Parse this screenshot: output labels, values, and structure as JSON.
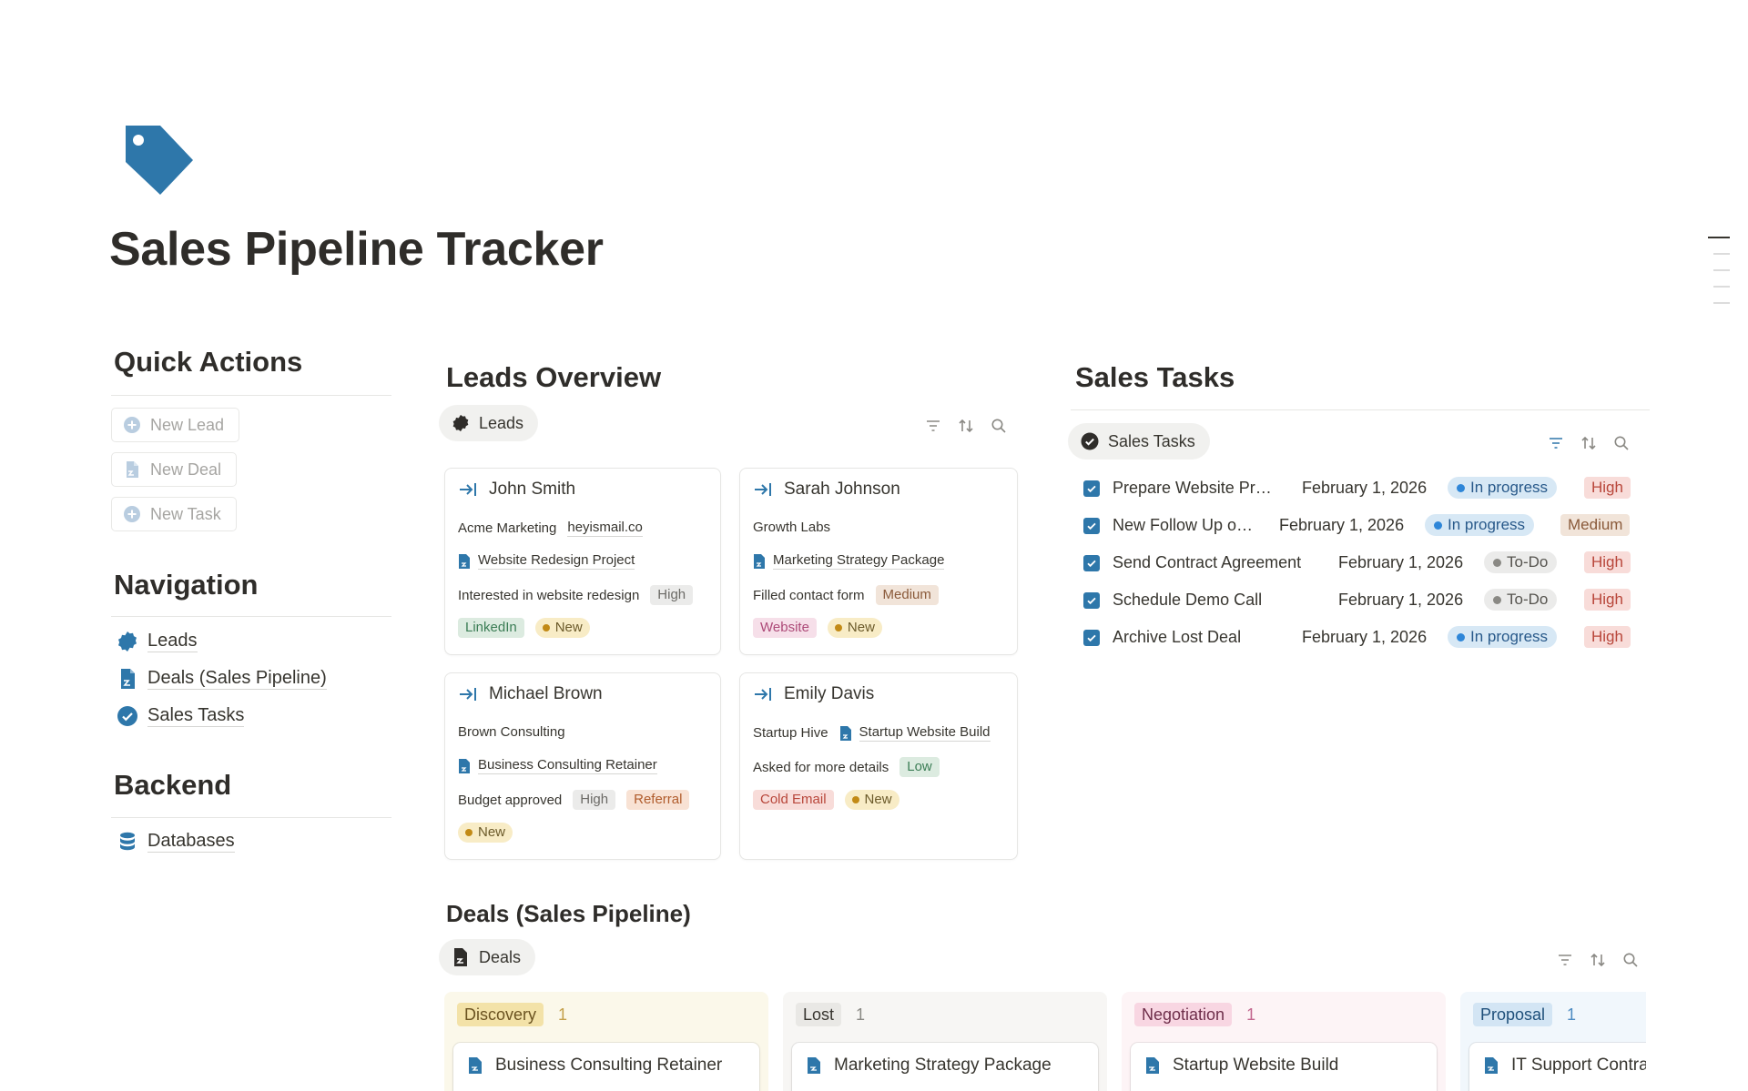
{
  "page": {
    "title": "Sales Pipeline Tracker",
    "icon": "price-tag-icon",
    "accent": "#2e77aa"
  },
  "quick_actions": {
    "heading": "Quick Actions",
    "buttons": [
      {
        "label": "New Lead",
        "icon": "plus-circle-icon"
      },
      {
        "label": "New Deal",
        "icon": "document-icon"
      },
      {
        "label": "New Task",
        "icon": "plus-circle-icon"
      }
    ]
  },
  "navigation": {
    "heading": "Navigation",
    "links": [
      {
        "label": "Leads",
        "icon": "badge-icon"
      },
      {
        "label": "Deals (Sales Pipeline)",
        "icon": "document-icon"
      },
      {
        "label": "Sales Tasks",
        "icon": "check-circle-icon"
      }
    ]
  },
  "backend": {
    "heading": "Backend",
    "links": [
      {
        "label": "Databases",
        "icon": "database-icon"
      }
    ]
  },
  "leads": {
    "heading": "Leads Overview",
    "view_label": "Leads",
    "cards": [
      {
        "name": "John Smith",
        "company": "Acme Marketing",
        "email": "heyismail.co",
        "deal": "Website Redesign Project",
        "note": "Interested in website redesign",
        "priority": "High",
        "source": "LinkedIn",
        "status": "New"
      },
      {
        "name": "Sarah Johnson",
        "company": "Growth Labs",
        "deal": "Marketing Strategy Package",
        "note": "Filled contact form",
        "priority": "Medium",
        "source": "Website",
        "status": "New"
      },
      {
        "name": "Michael Brown",
        "company": "Brown Consulting",
        "deal": "Business Consulting Retainer",
        "note": "Budget approved",
        "priority": "High",
        "source": "Referral",
        "status": "New"
      },
      {
        "name": "Emily Davis",
        "company": "Startup Hive",
        "deal": "Startup Website Build",
        "note": "Asked for more details",
        "priority": "Low",
        "source": "Cold Email",
        "status": "New"
      }
    ]
  },
  "tasks": {
    "heading": "Sales Tasks",
    "view_label": "Sales Tasks",
    "rows": [
      {
        "name": "Prepare Website Pr…",
        "date": "February 1, 2026",
        "status": "In progress",
        "priority": "High"
      },
      {
        "name": "New Follow Up o…",
        "date": "February 1, 2026",
        "status": "In progress",
        "priority": "Medium"
      },
      {
        "name": "Send Contract Agreement",
        "date": "February 1, 2026",
        "status": "To-Do",
        "priority": "High"
      },
      {
        "name": "Schedule Demo Call",
        "date": "February 1, 2026",
        "status": "To-Do",
        "priority": "High"
      },
      {
        "name": "Archive Lost Deal",
        "date": "February 1, 2026",
        "status": "In progress",
        "priority": "High"
      }
    ]
  },
  "deals": {
    "heading": "Deals (Sales Pipeline)",
    "view_label": "Deals",
    "columns": [
      {
        "label": "Discovery",
        "count": "1",
        "card": "Business Consulting Retainer"
      },
      {
        "label": "Lost",
        "count": "1",
        "card": "Marketing Strategy Package"
      },
      {
        "label": "Negotiation",
        "count": "1",
        "card": "Startup Website Build"
      },
      {
        "label": "Proposal",
        "count": "1",
        "card": "IT Support Contra"
      }
    ]
  }
}
